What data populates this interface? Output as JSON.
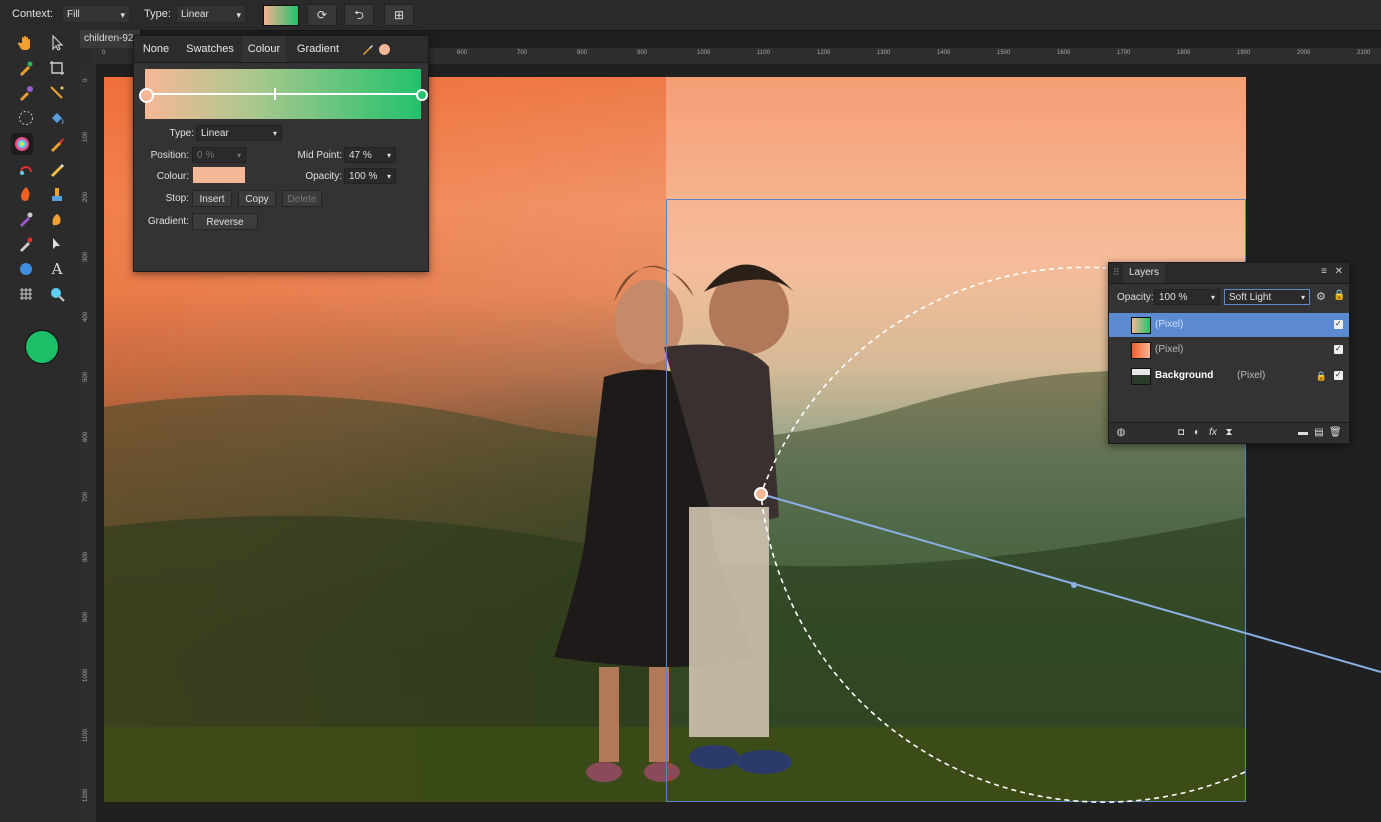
{
  "context_bar": {
    "context_label": "Context:",
    "context_value": "Fill",
    "type_label": "Type:",
    "type_value": "Linear"
  },
  "document": {
    "tab_title": "children-92"
  },
  "ruler": {
    "top_ticks": [
      "0",
      "600",
      "700",
      "800",
      "900",
      "1000",
      "1100",
      "1200",
      "1300",
      "1400",
      "1500",
      "1600",
      "1700",
      "1800",
      "1900",
      "2000",
      "2100"
    ],
    "left_ticks": [
      "0",
      "100",
      "200",
      "300",
      "400",
      "500",
      "600",
      "700",
      "800",
      "900",
      "1000",
      "1100",
      "1200"
    ]
  },
  "gradient_panel": {
    "tabs": [
      "None",
      "Swatches",
      "Colour",
      "Gradient"
    ],
    "active_tab": "Colour",
    "type_label": "Type:",
    "type_value": "Linear",
    "position_label": "Position:",
    "position_value": "0 %",
    "midpoint_label": "Mid Point:",
    "midpoint_value": "47 %",
    "colour_label": "Colour:",
    "opacity_label": "Opacity:",
    "opacity_value": "100 %",
    "stop_label": "Stop:",
    "insert_label": "Insert",
    "copy_label": "Copy",
    "delete_label": "Delete",
    "gradient_label": "Gradient:",
    "reverse_label": "Reverse",
    "start_color": "#f6b796",
    "end_color": "#22c16c"
  },
  "layers_panel": {
    "title": "Layers",
    "opacity_label": "Opacity:",
    "opacity_value": "100 %",
    "blend_mode": "Soft Light",
    "layers": [
      {
        "name": "",
        "type": "(Pixel)",
        "selected": true
      },
      {
        "name": "",
        "type": "(Pixel)",
        "selected": false
      },
      {
        "name": "Background",
        "type": "(Pixel)",
        "selected": false
      }
    ]
  },
  "colors": {
    "foreground": "#1dbf69",
    "selection_blue": "#5b8ad0"
  }
}
